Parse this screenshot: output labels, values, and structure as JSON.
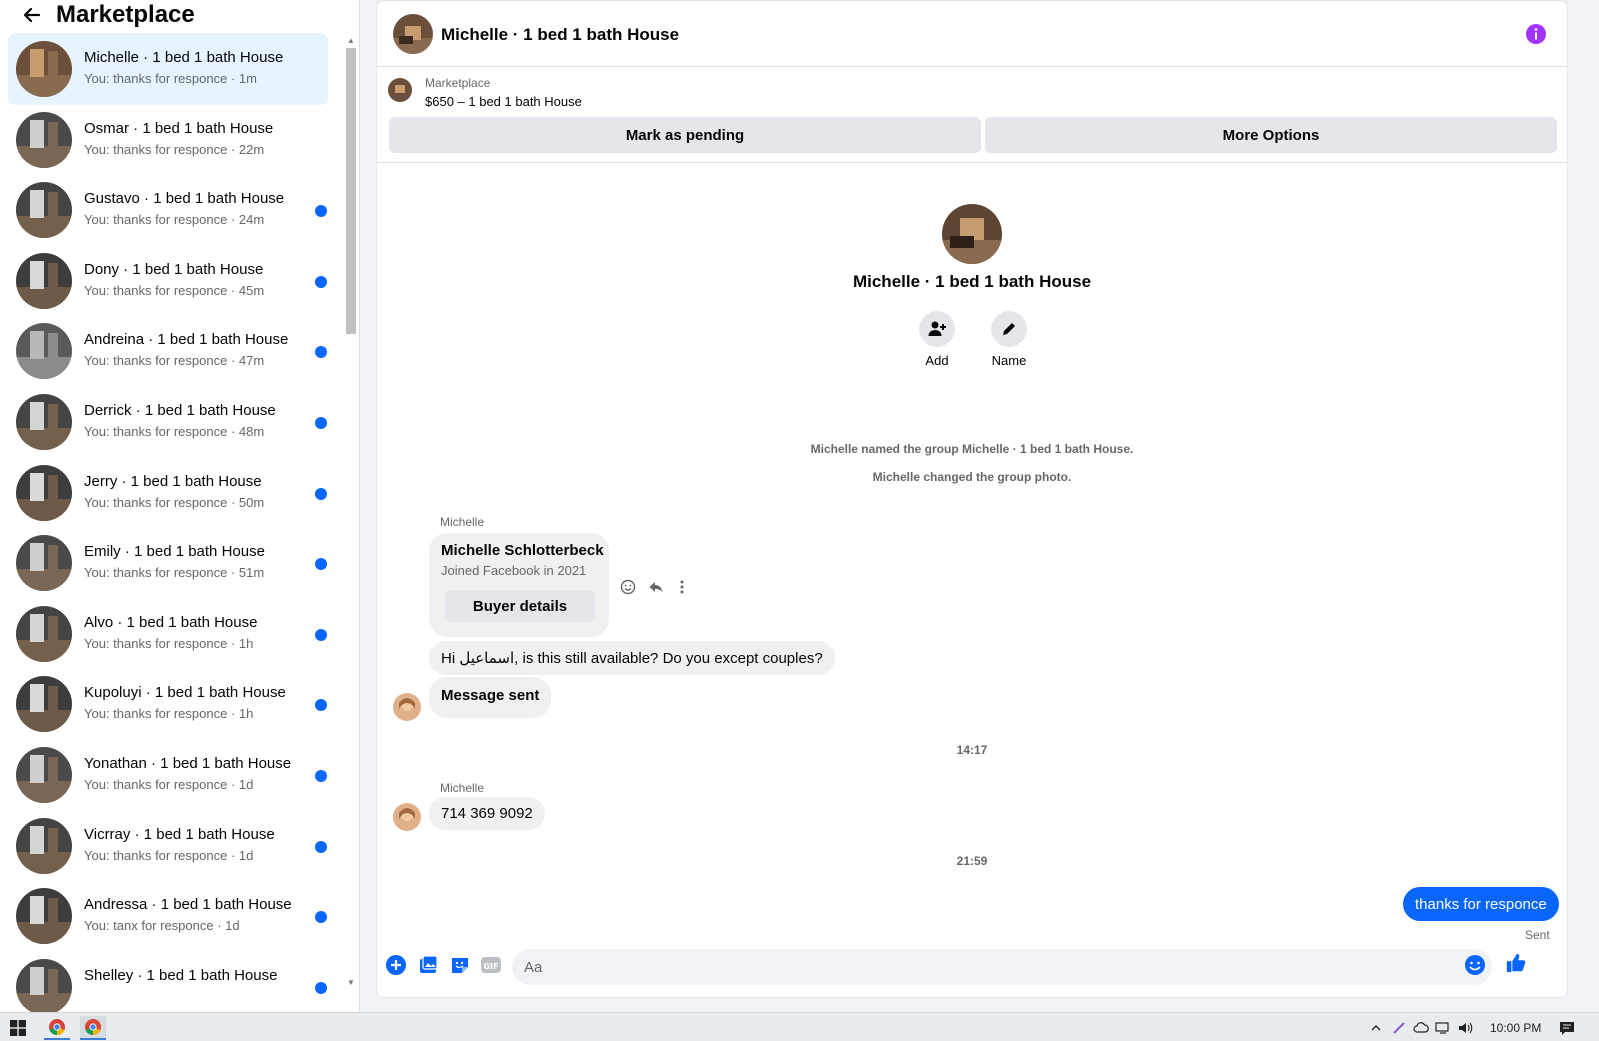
{
  "sidebar": {
    "title": "Marketplace",
    "conversations": [
      {
        "name": "Michelle · 1 bed 1 bath House",
        "preview": "You: thanks for responce · 1m",
        "unread": false,
        "active": true
      },
      {
        "name": "Osmar · 1 bed 1 bath House",
        "preview": "You: thanks for responce · 22m",
        "unread": false,
        "active": false
      },
      {
        "name": "Gustavo · 1 bed 1 bath House",
        "preview": "You: thanks for responce · 24m",
        "unread": true,
        "active": false
      },
      {
        "name": "Dony · 1 bed 1 bath House",
        "preview": "You: thanks for responce · 45m",
        "unread": true,
        "active": false
      },
      {
        "name": "Andreina · 1 bed 1 bath House",
        "preview": "You: thanks for responce · 47m",
        "unread": true,
        "active": false
      },
      {
        "name": "Derrick · 1 bed 1 bath House",
        "preview": "You: thanks for responce · 48m",
        "unread": true,
        "active": false
      },
      {
        "name": "Jerry · 1 bed 1 bath House",
        "preview": "You: thanks for responce · 50m",
        "unread": true,
        "active": false
      },
      {
        "name": "Emily · 1 bed 1 bath House",
        "preview": "You: thanks for responce · 51m",
        "unread": true,
        "active": false
      },
      {
        "name": "Alvo · 1 bed 1 bath House",
        "preview": "You: thanks for responce · 1h",
        "unread": true,
        "active": false
      },
      {
        "name": "Kupoluyi · 1 bed 1 bath House",
        "preview": "You: thanks for responce · 1h",
        "unread": true,
        "active": false
      },
      {
        "name": "Yonathan · 1 bed 1 bath House",
        "preview": "You: thanks for responce · 1d",
        "unread": true,
        "active": false
      },
      {
        "name": "Vicrray · 1 bed 1 bath House",
        "preview": "You: thanks for responce · 1d",
        "unread": true,
        "active": false
      },
      {
        "name": "Andressa · 1 bed 1 bath House",
        "preview": "You: tanx for responce · 1d",
        "unread": true,
        "active": false
      },
      {
        "name": "Shelley · 1 bed 1 bath House",
        "preview": "",
        "unread": true,
        "active": false
      }
    ]
  },
  "chat": {
    "title": "Michelle · 1 bed 1 bath House",
    "listing": {
      "source": "Marketplace",
      "title": "$650 – 1 bed 1 bath House",
      "pending_label": "Mark as pending",
      "options_label": "More Options"
    },
    "group": {
      "name": "Michelle · 1 bed 1 bath House",
      "add_label": "Add",
      "name_label": "Name"
    },
    "system_messages": [
      "Michelle named the group Michelle · 1 bed 1 bath House.",
      "Michelle changed the group photo."
    ],
    "sender_name": "Michelle",
    "card": {
      "name": "Michelle Schlotterbeck",
      "subtitle": "Joined Facebook in 2021",
      "button": "Buyer details"
    },
    "messages": {
      "inquiry": "Hi اسماعيل, is this still available? Do you except couples?",
      "auto_sent": "Message sent",
      "time1": "14:17",
      "phone": "714 369 9092",
      "time2": "21:59",
      "own_reply": "thanks for responce",
      "own_status": "Sent"
    },
    "composer": {
      "placeholder": "Aa"
    }
  },
  "taskbar": {
    "clock": "10:00 PM"
  },
  "colors": {
    "accent": "#0866ff",
    "info_icon": "#a033ff",
    "bubble_gray": "#f0f0f0",
    "active_row": "#e7f3ff"
  }
}
